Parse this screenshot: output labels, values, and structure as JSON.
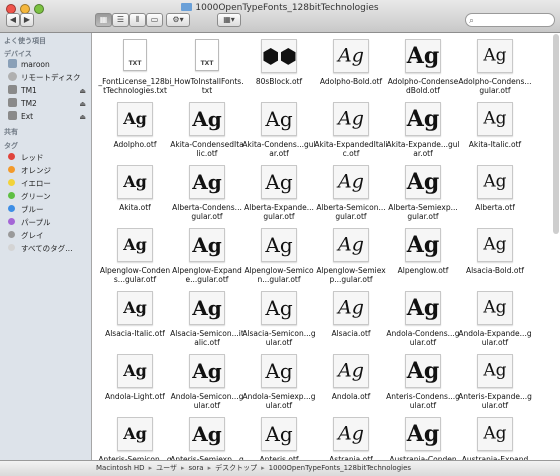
{
  "window": {
    "title": "1000OpenTypeFonts_128bitTechnologies"
  },
  "toolbar": {
    "search_placeholder": ""
  },
  "sidebar": {
    "favorites_header": "よく使う項目",
    "devices_header": "デバイス",
    "devices": [
      {
        "label": "maroon",
        "icon": "home-icon"
      },
      {
        "label": "リモートディスク",
        "icon": "disc-icon"
      },
      {
        "label": "TM1",
        "icon": "drive-icon",
        "eject": true
      },
      {
        "label": "TM2",
        "icon": "drive-icon",
        "eject": true
      },
      {
        "label": "Ext",
        "icon": "drive-icon",
        "eject": true
      }
    ],
    "shared_header": "共有",
    "tags_header": "タグ",
    "tags": [
      {
        "label": "レッド",
        "color": "#e0443c"
      },
      {
        "label": "オレンジ",
        "color": "#f39a2b"
      },
      {
        "label": "イエロー",
        "color": "#f2d33a"
      },
      {
        "label": "グリーン",
        "color": "#5fbf43"
      },
      {
        "label": "ブルー",
        "color": "#3d8ee5"
      },
      {
        "label": "パープル",
        "color": "#a466d6"
      },
      {
        "label": "グレイ",
        "color": "#9a9a9a"
      },
      {
        "label": "すべてのタグ…",
        "color": "#d4d4d4"
      }
    ]
  },
  "files": [
    {
      "name": "_FontLicense_128bitTechnologies.txt",
      "kind": "txt"
    },
    {
      "name": "_HowToInstallFonts.txt",
      "kind": "txt"
    },
    {
      "name": "80sBlock.otf",
      "kind": "font",
      "glyph": "⬢⬢"
    },
    {
      "name": "Adolpho-Bold.otf",
      "kind": "font",
      "glyph": "Ag"
    },
    {
      "name": "Adolpho-CondensedBold.otf",
      "kind": "font",
      "glyph": "Ag"
    },
    {
      "name": "Adolpho-Condens...gular.otf",
      "kind": "font",
      "glyph": "Ag"
    },
    {
      "name": "Adolpho.otf",
      "kind": "font",
      "glyph": "Ag"
    },
    {
      "name": "Akita-CondensedItalic.otf",
      "kind": "font",
      "glyph": "Ag"
    },
    {
      "name": "Akita-Condens...gular.otf",
      "kind": "font",
      "glyph": "Ag"
    },
    {
      "name": "Akita-ExpandedItalic.otf",
      "kind": "font",
      "glyph": "Ag"
    },
    {
      "name": "Akita-Expande...gular.otf",
      "kind": "font",
      "glyph": "Ag"
    },
    {
      "name": "Akita-Italic.otf",
      "kind": "font",
      "glyph": "Ag"
    },
    {
      "name": "Akita.otf",
      "kind": "font",
      "glyph": "Ag"
    },
    {
      "name": "Alberta-Condens...gular.otf",
      "kind": "font",
      "glyph": "Ag"
    },
    {
      "name": "Alberta-Expande...gular.otf",
      "kind": "font",
      "glyph": "Ag"
    },
    {
      "name": "Alberta-Semicon...gular.otf",
      "kind": "font",
      "glyph": "Ag"
    },
    {
      "name": "Alberta-Semiexp...gular.otf",
      "kind": "font",
      "glyph": "Ag"
    },
    {
      "name": "Alberta.otf",
      "kind": "font",
      "glyph": "Ag"
    },
    {
      "name": "Alpenglow-Condens...gular.otf",
      "kind": "font",
      "glyph": "Ag"
    },
    {
      "name": "Alpenglow-Expande...gular.otf",
      "kind": "font",
      "glyph": "Ag"
    },
    {
      "name": "Alpenglow-Semicon...gular.otf",
      "kind": "font",
      "glyph": "Ag"
    },
    {
      "name": "Alpenglow-Semiexp...gular.otf",
      "kind": "font",
      "glyph": "Ag"
    },
    {
      "name": "Alpenglow.otf",
      "kind": "font",
      "glyph": "Ag"
    },
    {
      "name": "Alsacia-Bold.otf",
      "kind": "font",
      "glyph": "Ag"
    },
    {
      "name": "Alsacia-Italic.otf",
      "kind": "font",
      "glyph": "Ag"
    },
    {
      "name": "Alsacia-Semicon...italic.otf",
      "kind": "font",
      "glyph": "Ag"
    },
    {
      "name": "Alsacia-Semicon...gular.otf",
      "kind": "font",
      "glyph": "Ag"
    },
    {
      "name": "Alsacia.otf",
      "kind": "font",
      "glyph": "Ag"
    },
    {
      "name": "Andola-Condens...gular.otf",
      "kind": "font",
      "glyph": "Ag"
    },
    {
      "name": "Andola-Expande...gular.otf",
      "kind": "font",
      "glyph": "Ag"
    },
    {
      "name": "Andola-Light.otf",
      "kind": "font",
      "glyph": "Ag"
    },
    {
      "name": "Andola-Semicon...gular.otf",
      "kind": "font",
      "glyph": "Ag"
    },
    {
      "name": "Andola-Semiexp...gular.otf",
      "kind": "font",
      "glyph": "Ag"
    },
    {
      "name": "Andola.otf",
      "kind": "font",
      "glyph": "Ag"
    },
    {
      "name": "Anteris-Condens...gular.otf",
      "kind": "font",
      "glyph": "Ag"
    },
    {
      "name": "Anteris-Expande...gular.otf",
      "kind": "font",
      "glyph": "Ag"
    },
    {
      "name": "Anteris-Semicon...gular.otf",
      "kind": "font",
      "glyph": "Ag"
    },
    {
      "name": "Anteris-Semiexp...gular.otf",
      "kind": "font",
      "glyph": "Ag"
    },
    {
      "name": "Anteris.otf",
      "kind": "font",
      "glyph": "Ag"
    },
    {
      "name": "Astrania.otf",
      "kind": "font",
      "glyph": "Ag"
    },
    {
      "name": "Austrania-Condens...gular.otf",
      "kind": "font",
      "glyph": "Ag"
    },
    {
      "name": "Austrania-Expande...gular.otf",
      "kind": "font",
      "glyph": "Ag"
    }
  ],
  "pathbar": {
    "items": [
      "Macintosh HD",
      "ユーザ",
      "sora",
      "デスクトップ",
      "1000OpenTypeFonts_128bitTechnologies"
    ]
  }
}
